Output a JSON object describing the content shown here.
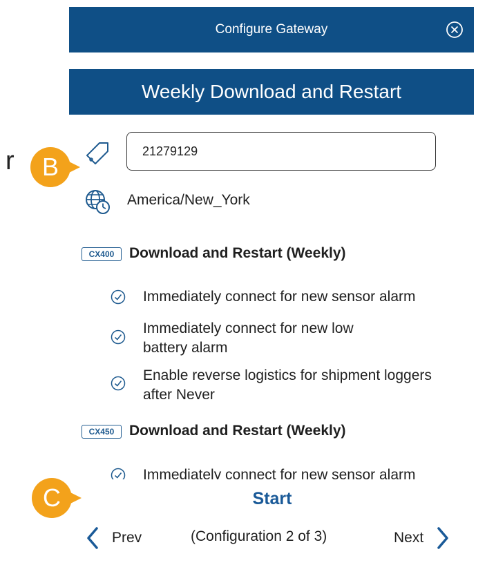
{
  "stray_text": "r",
  "header": {
    "title": "Configure Gateway",
    "close_icon": "close-circle-icon"
  },
  "section": {
    "title": "Weekly Download and Restart"
  },
  "markers": {
    "b": "B",
    "c": "C"
  },
  "serial": {
    "value": "21279129",
    "icon": "tag-icon"
  },
  "timezone": {
    "value": "America/New_York",
    "icon": "globe-clock-icon"
  },
  "groups": [
    {
      "model": "CX400",
      "heading": "Download and Restart (Weekly)",
      "options": [
        {
          "lines": [
            "Immediately connect for new sensor alarm"
          ]
        },
        {
          "lines": [
            "Immediately connect for new low",
            "battery alarm"
          ]
        },
        {
          "lines": [
            "Enable reverse logistics for shipment loggers",
            "after Never"
          ]
        }
      ]
    },
    {
      "model": "CX450",
      "heading": "Download and Restart (Weekly)",
      "options": [
        {
          "lines": [
            "Immediately connect for new sensor alarm"
          ]
        }
      ]
    }
  ],
  "footer": {
    "start_label": "Start",
    "prev_label": "Prev",
    "next_label": "Next",
    "progress": "(Configuration 2 of 3)"
  },
  "colors": {
    "header_bg": "#0f4f86",
    "accent": "#1a5a98",
    "marker": "#f3a21b"
  }
}
